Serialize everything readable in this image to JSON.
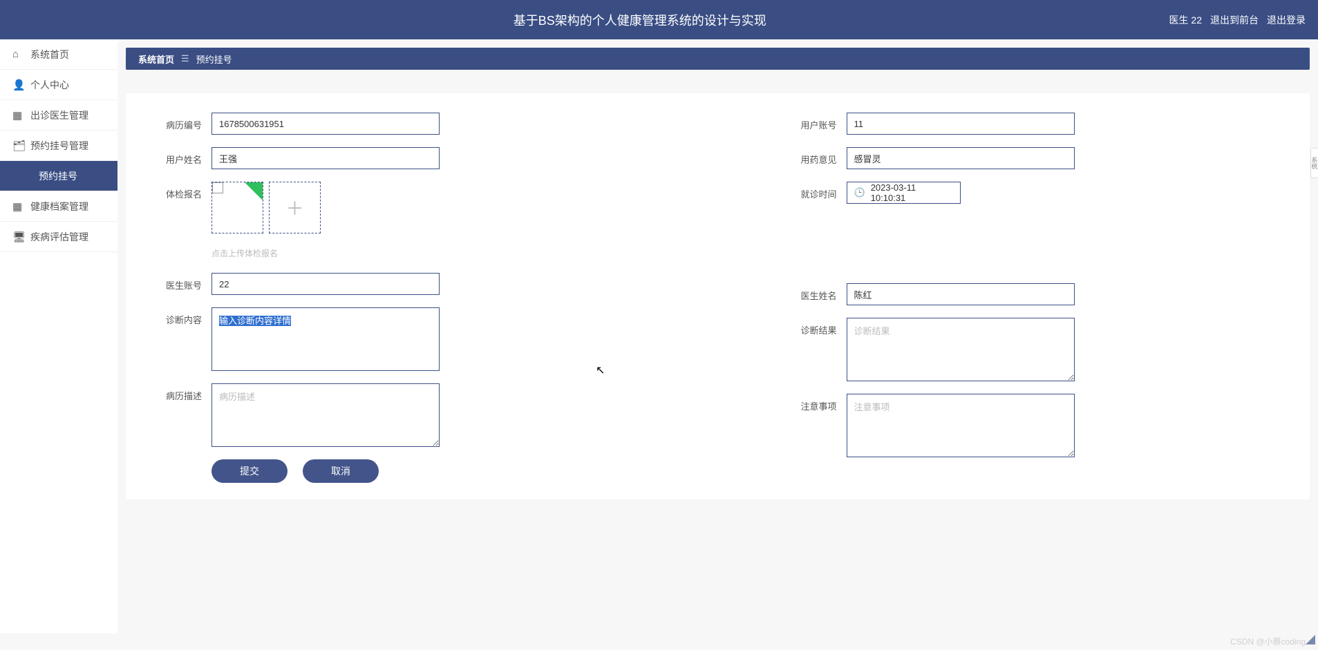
{
  "header": {
    "title": "基于BS架构的个人健康管理系统的设计与实现",
    "user": "医生 22",
    "to_front": "退出到前台",
    "logout": "退出登录"
  },
  "sidebar": {
    "items": [
      {
        "label": "系统首页",
        "icon": "⌂"
      },
      {
        "label": "个人中心",
        "icon": "👤"
      },
      {
        "label": "出诊医生管理",
        "icon": "▦"
      },
      {
        "label": "预约挂号管理",
        "icon": "🗂"
      },
      {
        "label": "预约挂号",
        "icon": "",
        "active": true
      },
      {
        "label": "健康档案管理",
        "icon": "▦"
      },
      {
        "label": "疾病评估管理",
        "icon": "🖥"
      }
    ]
  },
  "breadcrumb": {
    "home": "系统首页",
    "sep": "☰",
    "current": "预约挂号"
  },
  "form": {
    "record_no": {
      "label": "病历编号",
      "value": "1678500631951"
    },
    "user_account": {
      "label": "用户账号",
      "value": "11"
    },
    "user_name": {
      "label": "用户姓名",
      "value": "王强"
    },
    "medicine_advice": {
      "label": "用药意见",
      "value": "感冒灵"
    },
    "exam_report": {
      "label": "体检报名",
      "hint": "点击上传体检报名"
    },
    "visit_time": {
      "label": "就诊时间",
      "value": "2023-03-11 10:10:31"
    },
    "doctor_account": {
      "label": "医生账号",
      "value": "22"
    },
    "doctor_name": {
      "label": "医生姓名",
      "value": "陈红"
    },
    "diagnosis": {
      "label": "诊断内容",
      "value": "输入诊断内容详情"
    },
    "diagnosis_result": {
      "label": "诊断结果",
      "placeholder": "诊断结果"
    },
    "record_desc": {
      "label": "病历描述",
      "placeholder": "病历描述"
    },
    "notes": {
      "label": "注意事项",
      "placeholder": "注意事项"
    }
  },
  "buttons": {
    "submit": "提交",
    "cancel": "取消"
  },
  "footer": "CSDN @小蔡coding",
  "right_tab": "系统"
}
